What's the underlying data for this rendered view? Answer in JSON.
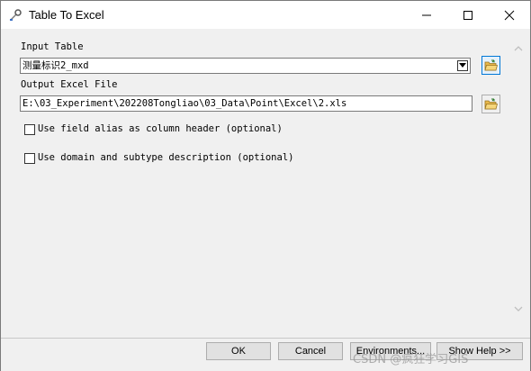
{
  "window": {
    "title": "Table To Excel"
  },
  "form": {
    "input_table": {
      "label": "Input Table",
      "value": "测量标识2_mxd"
    },
    "output_excel": {
      "label": "Output Excel File",
      "value": "E:\\03_Experiment\\202208Tongliao\\03_Data\\Point\\Excel\\2.xls"
    },
    "options": [
      {
        "label": "Use field alias as column header (optional)",
        "checked": false
      },
      {
        "label": "Use domain and subtype description (optional)",
        "checked": false
      }
    ]
  },
  "footer": {
    "ok_label": "OK",
    "cancel_label": "Cancel",
    "environments_label": "Environments...",
    "show_help_label": "Show Help >>"
  },
  "watermark": "CSDN @疯狂学习GIS",
  "colors": {
    "accent": "#0078d7",
    "folder": "#e8b84a"
  }
}
